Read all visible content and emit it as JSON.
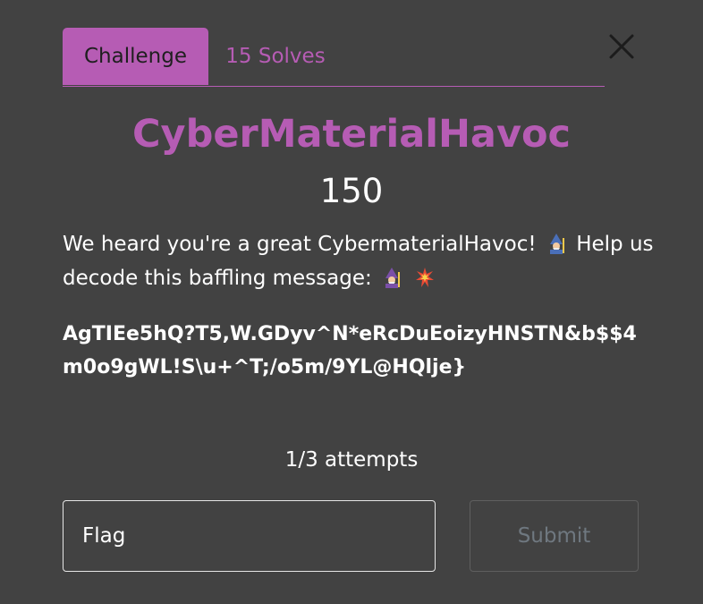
{
  "tabs": {
    "challenge_label": "Challenge",
    "solves_label": "15 Solves"
  },
  "challenge": {
    "title": "CyberMaterialHavoc",
    "points": "150",
    "description_part1": "We heard you're a great CybermaterialHavoc!",
    "description_part2": "Help us decode this baffling message:",
    "cipher_text": "AgTIEe5hQ?T5,W.GDyv^N*eRcDuEoizyHNSTN&b$$4m0o9gWL!S\\u+^T;/o5m/9YL@HQlje}",
    "attempts": "1/3 attempts"
  },
  "form": {
    "flag_placeholder": "Flag",
    "flag_value": "",
    "submit_label": "Submit"
  },
  "icons": {
    "close": "close-icon",
    "emoji_1": "mage-emoji-icon",
    "emoji_2": "mage-emoji-icon",
    "emoji_3": "collision-emoji-icon"
  },
  "colors": {
    "background": "#424242",
    "accent": "#b65cb4",
    "text": "#ffffff",
    "muted": "#6f7880"
  }
}
